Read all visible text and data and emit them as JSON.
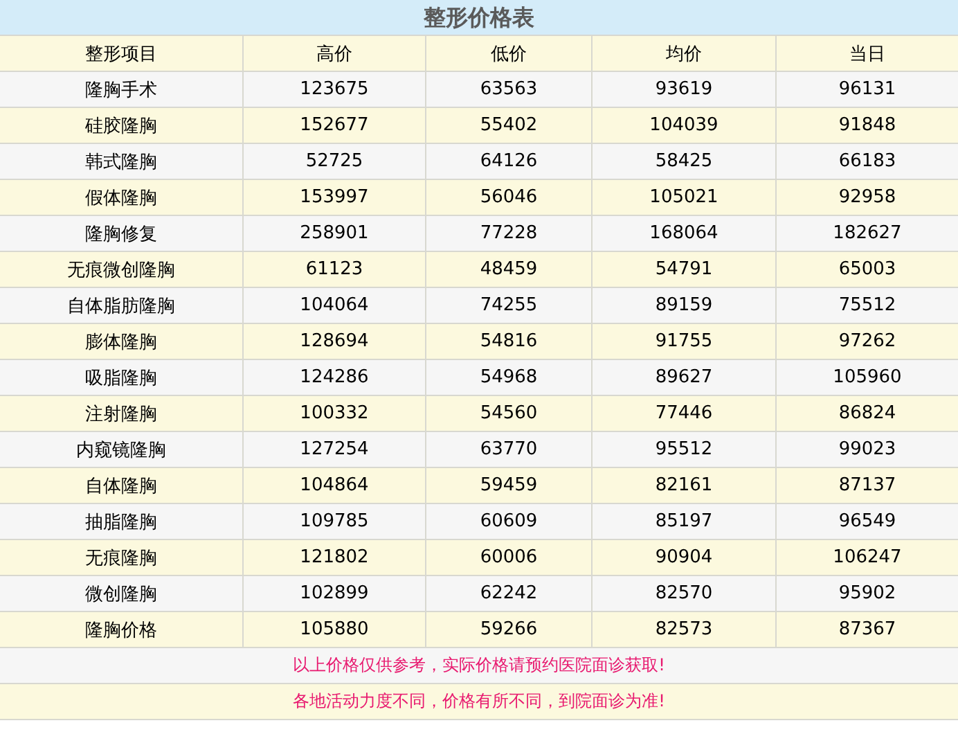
{
  "title": "整形价格表",
  "table": {
    "columns": [
      "整形项目",
      "高价",
      "低价",
      "均价",
      "当日"
    ],
    "rows": [
      [
        "隆胸手术",
        "123675",
        "63563",
        "93619",
        "96131"
      ],
      [
        "硅胶隆胸",
        "152677",
        "55402",
        "104039",
        "91848"
      ],
      [
        "韩式隆胸",
        "52725",
        "64126",
        "58425",
        "66183"
      ],
      [
        "假体隆胸",
        "153997",
        "56046",
        "105021",
        "92958"
      ],
      [
        "隆胸修复",
        "258901",
        "77228",
        "168064",
        "182627"
      ],
      [
        "无痕微创隆胸",
        "61123",
        "48459",
        "54791",
        "65003"
      ],
      [
        "自体脂肪隆胸",
        "104064",
        "74255",
        "89159",
        "75512"
      ],
      [
        "膨体隆胸",
        "128694",
        "54816",
        "91755",
        "97262"
      ],
      [
        "吸脂隆胸",
        "124286",
        "54968",
        "89627",
        "105960"
      ],
      [
        "注射隆胸",
        "100332",
        "54560",
        "77446",
        "86824"
      ],
      [
        "内窥镜隆胸",
        "127254",
        "63770",
        "95512",
        "99023"
      ],
      [
        "自体隆胸",
        "104864",
        "59459",
        "82161",
        "87137"
      ],
      [
        "抽脂隆胸",
        "109785",
        "60609",
        "85197",
        "96549"
      ],
      [
        "无痕隆胸",
        "121802",
        "60006",
        "90904",
        "106247"
      ],
      [
        "微创隆胸",
        "102899",
        "62242",
        "82570",
        "95902"
      ],
      [
        "隆胸价格",
        "105880",
        "59266",
        "82573",
        "87367"
      ]
    ]
  },
  "notes": [
    "以上价格仅供参考，实际价格请预约医院面诊获取!",
    "各地活动力度不同，价格有所不同，到院面诊为准!"
  ]
}
